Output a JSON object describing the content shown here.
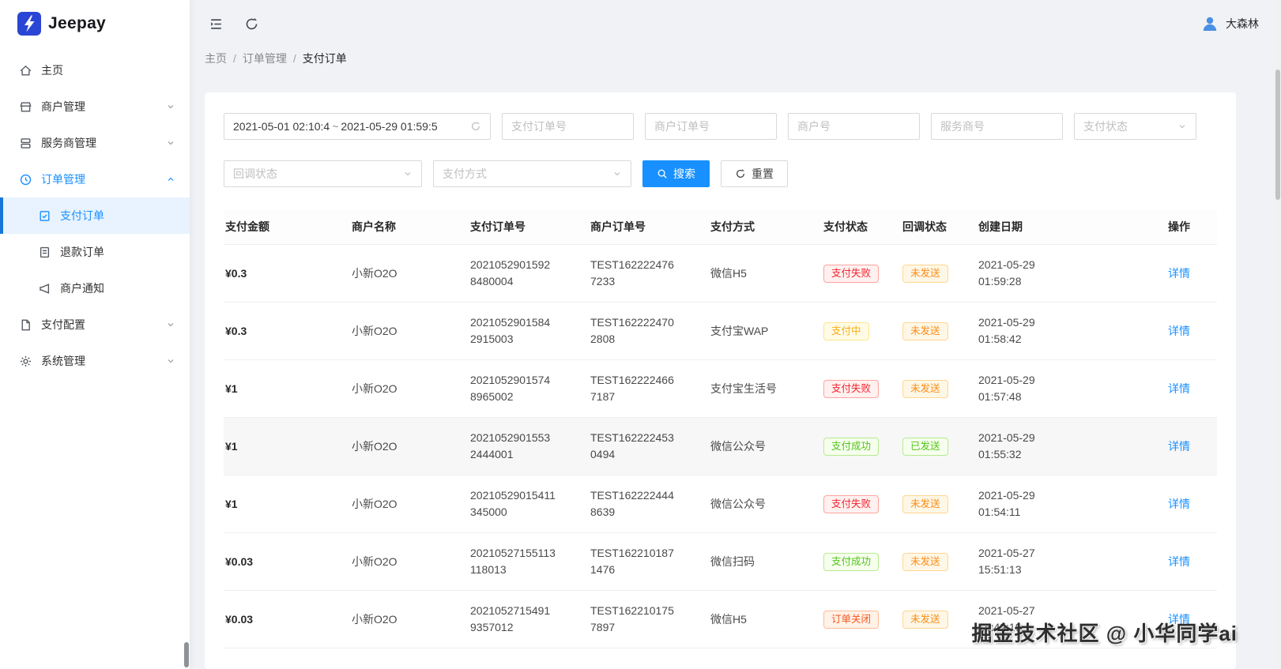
{
  "brand": {
    "name": "Jeepay"
  },
  "topbar": {
    "username": "大森林"
  },
  "breadcrumb": [
    "主页",
    "订单管理",
    "支付订单"
  ],
  "sidebar": {
    "items": [
      {
        "label": "主页"
      },
      {
        "label": "商户管理"
      },
      {
        "label": "服务商管理"
      },
      {
        "label": "订单管理",
        "expanded": true,
        "children": [
          {
            "label": "支付订单",
            "active": true
          },
          {
            "label": "退款订单"
          },
          {
            "label": "商户通知"
          }
        ]
      },
      {
        "label": "支付配置"
      },
      {
        "label": "系统管理"
      }
    ]
  },
  "filters": {
    "date_start": "2021-05-01 02:10:4",
    "date_separator": "~",
    "date_end": "2021-05-29 01:59:5",
    "pay_order_no_placeholder": "支付订单号",
    "mch_order_no_placeholder": "商户订单号",
    "mch_no_placeholder": "商户号",
    "isv_no_placeholder": "服务商号",
    "pay_state_placeholder": "支付状态",
    "notify_state_placeholder": "回调状态",
    "pay_way_placeholder": "支付方式",
    "search_label": "搜索",
    "reset_label": "重置"
  },
  "table": {
    "columns": [
      "支付金额",
      "商户名称",
      "支付订单号",
      "商户订单号",
      "支付方式",
      "支付状态",
      "回调状态",
      "创建日期",
      "操作"
    ],
    "action_label": "详情",
    "rows": [
      {
        "amount": "¥0.3",
        "merchant": "小新O2O",
        "pay_order_no": "20210529015928480004",
        "mch_order_no": "TEST1622224767233",
        "pay_way": "微信H5",
        "pay_state": {
          "text": "支付失败",
          "type": "red"
        },
        "notify_state": {
          "text": "未发送",
          "type": "orange"
        },
        "created": "2021-05-29 01:59:28"
      },
      {
        "amount": "¥0.3",
        "merchant": "小新O2O",
        "pay_order_no": "20210529015842915003",
        "mch_order_no": "TEST1622224702808",
        "pay_way": "支付宝WAP",
        "pay_state": {
          "text": "支付中",
          "type": "gold"
        },
        "notify_state": {
          "text": "未发送",
          "type": "orange"
        },
        "created": "2021-05-29 01:58:42"
      },
      {
        "amount": "¥1",
        "merchant": "小新O2O",
        "pay_order_no": "20210529015748965002",
        "mch_order_no": "TEST1622224667187",
        "pay_way": "支付宝生活号",
        "pay_state": {
          "text": "支付失败",
          "type": "red"
        },
        "notify_state": {
          "text": "未发送",
          "type": "orange"
        },
        "created": "2021-05-29 01:57:48"
      },
      {
        "amount": "¥1",
        "merchant": "小新O2O",
        "pay_order_no": "20210529015532444001",
        "mch_order_no": "TEST1622224530494",
        "pay_way": "微信公众号",
        "pay_state": {
          "text": "支付成功",
          "type": "green"
        },
        "notify_state": {
          "text": "已发送",
          "type": "green"
        },
        "created": "2021-05-29 01:55:32",
        "highlighted": true
      },
      {
        "amount": "¥1",
        "merchant": "小新O2O",
        "pay_order_no": "20210529015411345000",
        "mch_order_no": "TEST1622224448639",
        "pay_way": "微信公众号",
        "pay_state": {
          "text": "支付失败",
          "type": "red"
        },
        "notify_state": {
          "text": "未发送",
          "type": "orange"
        },
        "created": "2021-05-29 01:54:11"
      },
      {
        "amount": "¥0.03",
        "merchant": "小新O2O",
        "pay_order_no": "20210527155113118013",
        "mch_order_no": "TEST1622101871476",
        "pay_way": "微信扫码",
        "pay_state": {
          "text": "支付成功",
          "type": "green"
        },
        "notify_state": {
          "text": "未发送",
          "type": "orange"
        },
        "created": "2021-05-27 15:51:13"
      },
      {
        "amount": "¥0.03",
        "merchant": "小新O2O",
        "pay_order_no": "20210527154919357012",
        "mch_order_no": "TEST1622101757897",
        "pay_way": "微信H5",
        "pay_state": {
          "text": "订单关闭",
          "type": "volcano"
        },
        "notify_state": {
          "text": "未发送",
          "type": "orange"
        },
        "created": "2021-05-27 15:49:19"
      }
    ]
  },
  "watermark": "掘金技术社区 @ 小华同学ai",
  "icons": {
    "collapse_menu": "fold-lines",
    "refresh": "circular-arrow",
    "avatar": "user-silhouette",
    "home": "house-outline",
    "merchant_mgmt": "storefront-outline",
    "isv_mgmt": "layers-outline",
    "order_mgmt": "clock-circle-outline",
    "pay_orders": "document-check-outline",
    "refund_orders": "document-lines-outline",
    "merchant_notify": "megaphone-outline",
    "pay_config": "file-outline",
    "sys_mgmt": "gear-outline",
    "select_chevron": "chevron-down",
    "search": "magnifier",
    "reset": "circular-arrow",
    "date_suffix": "circular-arrow"
  },
  "colors": {
    "primary": "#1890ff",
    "brand_logo": "#2a46d4",
    "success": "#52c41a",
    "error": "#f5222d",
    "warning": "#faad14",
    "notify_pending": "#fa8c16",
    "closed": "#fa541c"
  }
}
